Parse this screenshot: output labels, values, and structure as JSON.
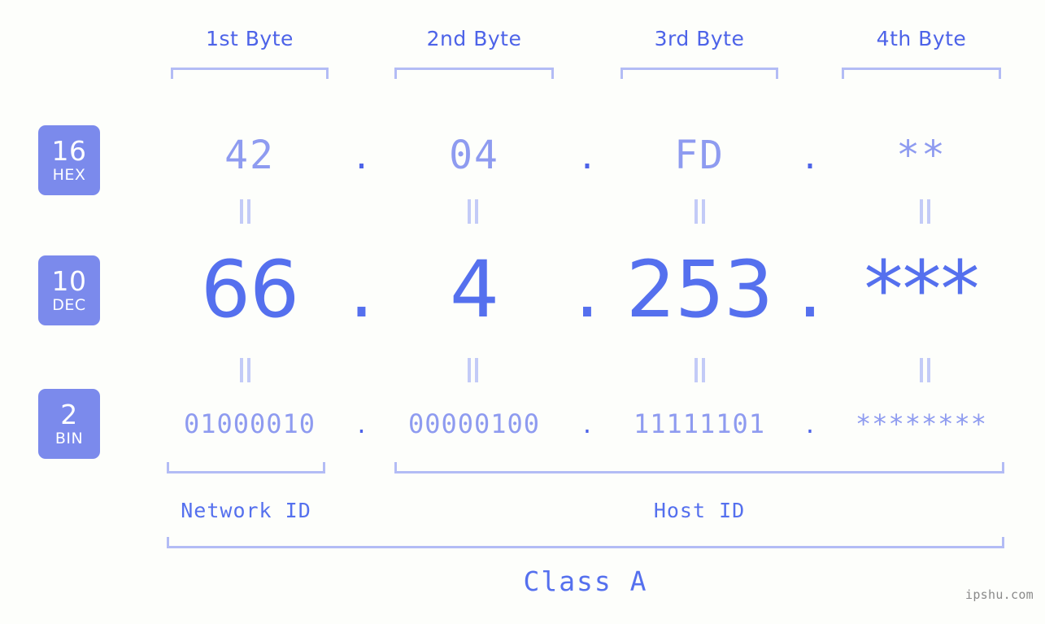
{
  "meta": {
    "watermark": "ipshu.com",
    "accent_strong": "#4d63e8",
    "accent_mid": "#5570ee",
    "accent_light": "#8e9bf0",
    "accent_pale": "#b3bcf5",
    "badge_bg": "#7b8aec",
    "background": "#fdfefb"
  },
  "byte_headers": [
    {
      "label": "1st Byte"
    },
    {
      "label": "2nd Byte"
    },
    {
      "label": "3rd Byte"
    },
    {
      "label": "4th Byte"
    }
  ],
  "bases": [
    {
      "key": "hex",
      "number": "16",
      "name": "HEX"
    },
    {
      "key": "dec",
      "number": "10",
      "name": "DEC"
    },
    {
      "key": "bin",
      "number": "2",
      "name": "BIN"
    }
  ],
  "rows": {
    "hex": {
      "values": [
        "42",
        "04",
        "FD",
        "**"
      ],
      "separator": "."
    },
    "dec": {
      "values": [
        "66",
        "4",
        "253",
        "***"
      ],
      "separator": "."
    },
    "bin": {
      "values": [
        "01000010",
        "00000100",
        "11111101",
        "********"
      ],
      "separator": "."
    }
  },
  "equals_marks": {
    "glyph": "||",
    "count_per_row": 4
  },
  "segments": {
    "network_id": {
      "label": "Network ID"
    },
    "host_id": {
      "label": "Host ID"
    },
    "address_class": {
      "label": "Class A"
    }
  }
}
